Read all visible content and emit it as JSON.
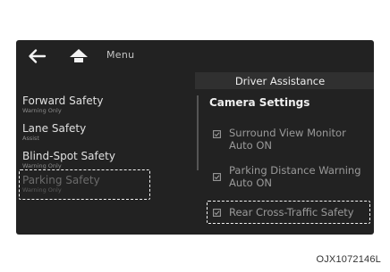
{
  "topbar": {
    "back_icon": "back-arrow-icon",
    "home_icon": "home-icon",
    "menu_label": "Menu"
  },
  "panel": {
    "title": "Driver Assistance"
  },
  "left_menu": {
    "items": [
      {
        "label": "Forward Safety",
        "sub": "Warning Only"
      },
      {
        "label": "Lane Safety",
        "sub": "Assist"
      },
      {
        "label": "Blind-Spot Safety",
        "sub": "Warning Only"
      },
      {
        "label": "Parking Safety",
        "sub": "Warning Only"
      }
    ]
  },
  "camera": {
    "title": "Camera Settings",
    "options": [
      {
        "line1": "Surround View Monitor",
        "line2": "Auto ON",
        "checked": true
      },
      {
        "line1": "Parking Distance Warning",
        "line2": "Auto ON",
        "checked": true
      },
      {
        "line1": "Rear Cross-Traffic Safety",
        "line2": "",
        "checked": true
      }
    ]
  },
  "caption": "OJX1072146L",
  "colors": {
    "screen_bg": "#222222",
    "text_primary": "#e0e0e0",
    "text_muted": "#9a9a9a",
    "highlight": "#f4f4f4"
  }
}
